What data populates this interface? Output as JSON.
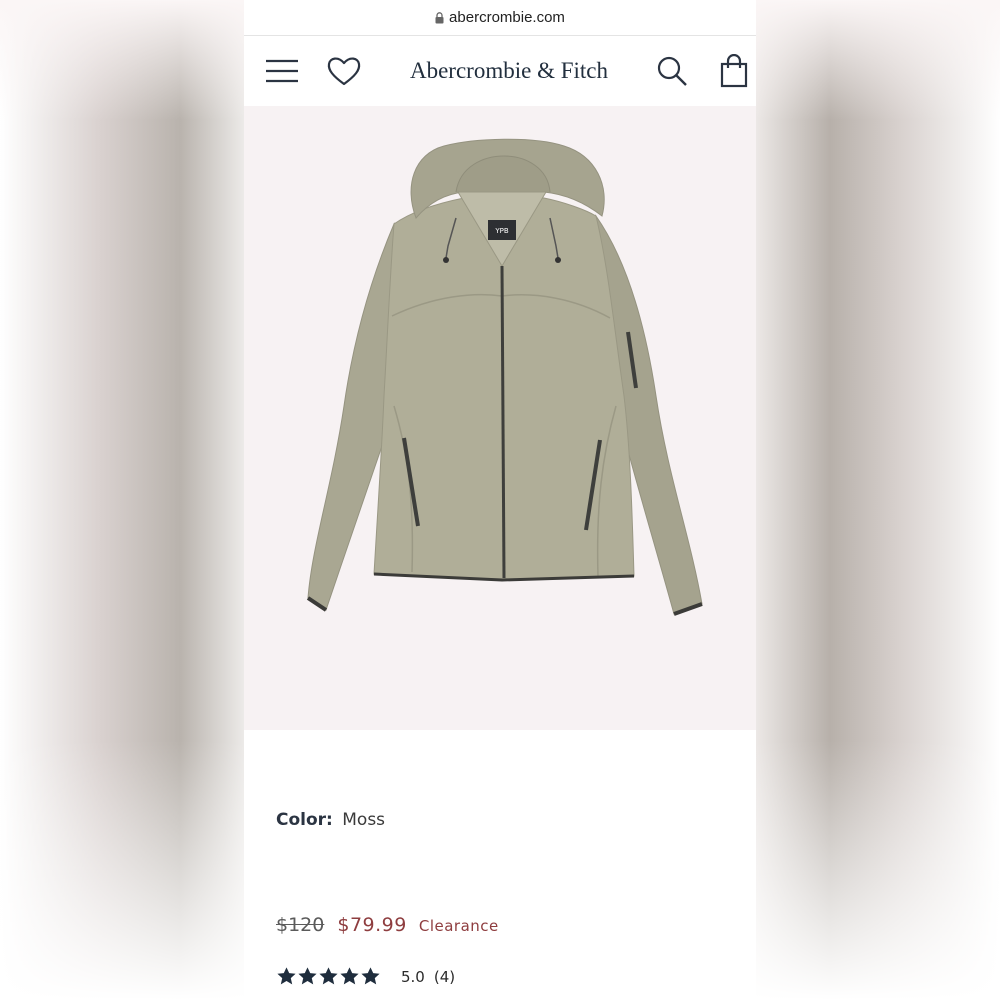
{
  "browser": {
    "url": "abercrombie.com"
  },
  "header": {
    "brand": "Abercrombie & Fitch",
    "icons": [
      "menu-icon",
      "heart-icon",
      "search-icon",
      "shopping-bag-icon"
    ]
  },
  "product": {
    "image_alt": "Moss lightweight hooded jacket",
    "tag_text": "YPB",
    "color_label": "Color:",
    "color_value": "Moss",
    "original_price": "$120",
    "sale_price": "$79.99",
    "badge": "Clearance",
    "rating": {
      "stars": 5,
      "value": "5.0",
      "count": "(4)"
    }
  },
  "colors": {
    "brand_navy": "#222f3e",
    "sale_red": "#8e3d3f",
    "jacket_moss": "#a8a791",
    "star": "#1f2d3d"
  }
}
